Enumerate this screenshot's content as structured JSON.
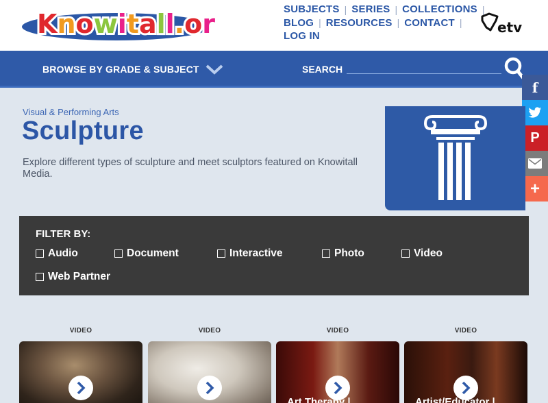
{
  "header": {
    "logo_text": "Knowitall.org",
    "nav": [
      [
        "SUBJECTS",
        "SERIES",
        "COLLECTIONS"
      ],
      [
        "BLOG",
        "RESOURCES",
        "CONTACT"
      ],
      [
        "LOG IN"
      ]
    ],
    "partner_logo": "etv"
  },
  "bar": {
    "browse_label": "BROWSE BY GRADE & SUBJECT",
    "search_label": "SEARCH",
    "search_value": ""
  },
  "social": [
    {
      "name": "facebook",
      "glyph": "f",
      "color": "#3b5998"
    },
    {
      "name": "twitter",
      "glyph": "twitter-bird-icon",
      "color": "#1da1f2"
    },
    {
      "name": "pinterest",
      "glyph": "P",
      "color": "#cb2027"
    },
    {
      "name": "email",
      "glyph": "envelope-icon",
      "color": "#7c7c7c"
    },
    {
      "name": "more",
      "glyph": "+",
      "color": "#f5694d"
    }
  ],
  "hero": {
    "breadcrumb": "Visual & Performing Arts",
    "title": "Sculpture",
    "description": "Explore different types of sculpture and meet sculptors featured on Knowitall Media.",
    "image_icon": "greek-column-icon"
  },
  "filter": {
    "title": "FILTER BY:",
    "options": [
      "Audio",
      "Document",
      "Interactive",
      "Photo",
      "Video",
      "Web Partner"
    ]
  },
  "cards": [
    {
      "label": "VIDEO",
      "title": ""
    },
    {
      "label": "VIDEO",
      "title": ""
    },
    {
      "label": "VIDEO",
      "title": "Art Therapy |"
    },
    {
      "label": "VIDEO",
      "title": "Artist/Educator |"
    }
  ],
  "colors": {
    "brand_blue": "#2f5aa8",
    "title_blue": "#2c56a6",
    "filter_bg": "#3a3a3a"
  }
}
